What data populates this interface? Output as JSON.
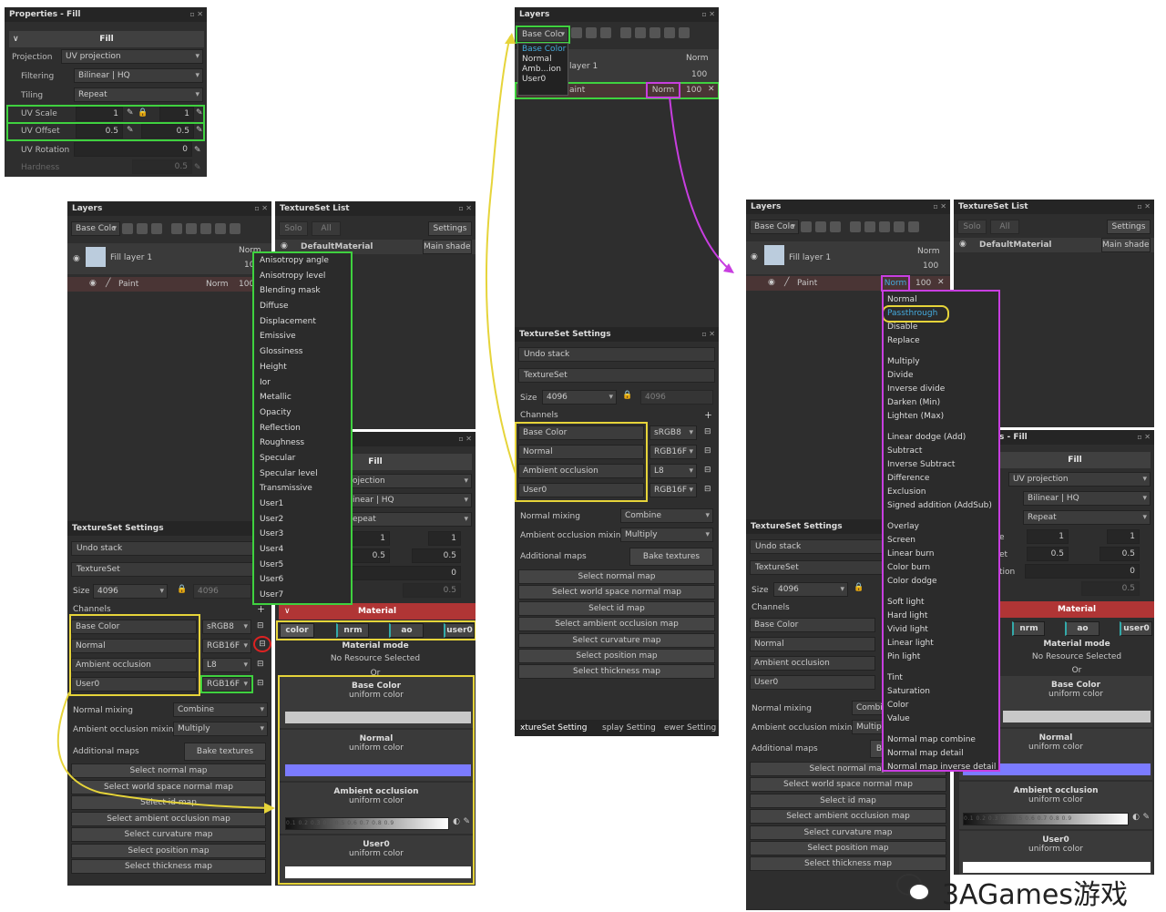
{
  "props1": {
    "title": "Properties - Fill",
    "header": "Fill",
    "rows": [
      {
        "label": "Projection",
        "value": "UV projection"
      },
      {
        "label": "Filtering",
        "value": "Bilinear | HQ"
      },
      {
        "label": "Tiling",
        "value": "Repeat"
      }
    ],
    "uv_scale": {
      "label": "UV Scale",
      "a": "1",
      "b": "1"
    },
    "uv_offset": {
      "label": "UV Offset",
      "a": "0.5",
      "b": "0.5"
    },
    "uv_rotation": {
      "label": "UV Rotation",
      "a": "0"
    },
    "hardness": {
      "label": "Hardness",
      "a": "0.5"
    }
  },
  "layers_left": {
    "title": "Layers",
    "channel": "Base Colc",
    "layer1": "Fill layer 1",
    "layer1_mode": "Norm",
    "layer1_val": "100",
    "paint": "Paint",
    "paint_mode": "Norm",
    "paint_val": "100"
  },
  "channel_list": [
    "Anisotropy angle",
    "Anisotropy level",
    "Blending mask",
    "Diffuse",
    "Displacement",
    "Emissive",
    "Glossiness",
    "Height",
    "Ior",
    "Metallic",
    "Opacity",
    "Reflection",
    "Roughness",
    "Specular",
    "Specular level",
    "Transmissive",
    "User1",
    "User2",
    "User3",
    "User4",
    "User5",
    "User6",
    "User7"
  ],
  "textureset_list": {
    "title": "TextureSet List",
    "solo": "Solo",
    "all": "All",
    "settings": "Settings",
    "material": "DefaultMaterial",
    "shader": "Main shader"
  },
  "props_mid": {
    "header": "Fill",
    "projection": "ojection",
    "filtering": "inear | HQ",
    "tiling": "epeat",
    "s1": "1",
    "s2": "1",
    "o1": "0.5",
    "o2": "0.5",
    "r": "0",
    "h": "0.5"
  },
  "material": {
    "title": "Material",
    "channels": [
      "color",
      "nrm",
      "ao",
      "user0"
    ],
    "mode": "Material mode",
    "resource": "No Resource Selected",
    "or": "Or",
    "blocks": [
      {
        "name": "Base Color",
        "sub": "uniform color",
        "swatch": "#c8c8c8"
      },
      {
        "name": "Normal",
        "sub": "uniform color",
        "swatch": "#7b7bff"
      },
      {
        "name": "Ambient occlusion",
        "sub": "uniform color",
        "swatch": "slider"
      },
      {
        "name": "User0",
        "sub": "uniform color",
        "swatch": "#ffffff"
      }
    ],
    "slider_ticks": "0.1  0.2  0.3  0.4  0.5  0.6  0.7  0.8  0.9"
  },
  "tss": {
    "title": "TextureSet Settings",
    "undo": "Undo stack",
    "textureset": "TextureSet",
    "size_label": "Size",
    "size": "4096",
    "size2": "4096",
    "channels": "Channels",
    "channel_rows": [
      {
        "name": "Base Color",
        "fmt": "sRGB8"
      },
      {
        "name": "Normal",
        "fmt": "RGB16F"
      },
      {
        "name": "Ambient occlusion",
        "fmt": "L8"
      },
      {
        "name": "User0",
        "fmt": "RGB16F"
      }
    ],
    "normal_mixing": "Normal mixing",
    "combine": "Combine",
    "ao_mixing": "Ambient occlusion mixing",
    "multiply": "Multiply",
    "additional": "Additional maps",
    "bake": "Bake textures",
    "maps": [
      "Select normal map",
      "Select world space normal map",
      "Select id map",
      "Select ambient occlusion map",
      "Select curvature map",
      "Select position map",
      "Select thickness map"
    ],
    "tabs": [
      "xtureSet Setting",
      "splay Setting",
      "ewer Setting"
    ]
  },
  "layers_top": {
    "title": "Layers",
    "channel": "Base Colc",
    "menu": [
      "Base Color",
      "Normal",
      "Amb...ion",
      "User0"
    ],
    "layer1": "layer 1",
    "mode": "Norm",
    "val": "100",
    "paint": "aint",
    "paint_mode": "Norm",
    "paint_val": "100"
  },
  "layers_right": {
    "title": "Layers",
    "channel": "Base Colc",
    "layer1": "Fill layer 1",
    "mode": "Norm",
    "val": "100",
    "paint": "Paint",
    "paint_mode": "Norm",
    "paint_val": "100"
  },
  "blend_modes": [
    [
      "Normal",
      "Passthrough",
      "Disable",
      "Replace"
    ],
    [
      "Multiply",
      "Divide",
      "Inverse divide",
      "Darken (Min)",
      "Lighten (Max)"
    ],
    [
      "Linear dodge (Add)",
      "Subtract",
      "Inverse Subtract",
      "Difference",
      "Exclusion",
      "Signed addition (AddSub)"
    ],
    [
      "Overlay",
      "Screen",
      "Linear burn",
      "Color burn",
      "Color dodge"
    ],
    [
      "Soft light",
      "Hard light",
      "Vivid light",
      "Linear light",
      "Pin light"
    ],
    [
      "Tint",
      "Saturation",
      "Color",
      "Value"
    ],
    [
      "Normal map combine",
      "Normal map detail",
      "Normal map inverse detail"
    ]
  ],
  "props_right": {
    "title": "s - Fill",
    "header": "Fill",
    "projection": "UV projection",
    "filtering": "Bilinear | HQ",
    "tiling": "Repeat",
    "e": "e",
    "et": "et",
    "tion": "tion"
  },
  "tss_right": {
    "combine_trunc": "Combi",
    "multiply_trunc": "Multipl",
    "bake_trunc": "B"
  },
  "watermark": "3AGames游戏"
}
